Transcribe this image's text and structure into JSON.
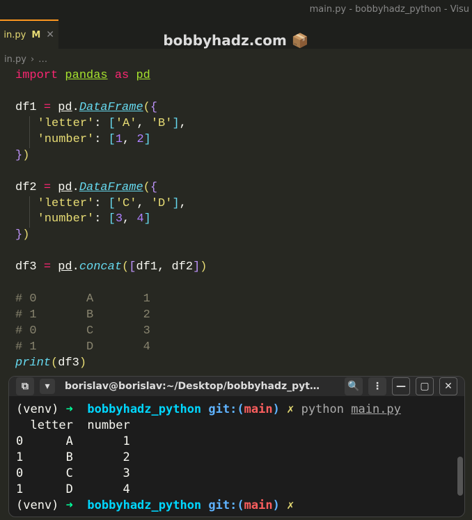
{
  "window": {
    "title": "main.py - bobbyhadz_python - Visu"
  },
  "tab": {
    "filename": "in.py",
    "modified_badge": "M",
    "close": "✕"
  },
  "watermark": {
    "text": "bobbyhadz.com",
    "icon": "📦"
  },
  "breadcrumb": {
    "file": "in.py",
    "sep": "›",
    "rest": "…"
  },
  "code": {
    "kw_import": "import",
    "mod_pandas": "pandas",
    "kw_as": "as",
    "alias_pd": "pd",
    "df1": "df1",
    "df2": "df2",
    "df3": "df3",
    "eq": "=",
    "pd": "pd",
    "dot": ".",
    "DataFrame": "DataFrame",
    "concat": "concat",
    "lparen_y": "(",
    "rparen_y": ")",
    "lbrace": "{",
    "rbrace": "}",
    "lbrack": "[",
    "rbrack": "]",
    "key_letter": "'letter'",
    "key_number": "'number'",
    "colon": ":",
    "comma": ",",
    "strA": "'A'",
    "strB": "'B'",
    "strC": "'C'",
    "strD": "'D'",
    "n1": "1",
    "n2": "2",
    "n3": "3",
    "n4": "4",
    "c1": "# 0       A       1",
    "c2": "# 1       B       2",
    "c3": "# 0       C       3",
    "c4": "# 1       D       4",
    "print": "print"
  },
  "terminal": {
    "header_title": "borislav@borislav:~/Desktop/bobbyhadz_pyt…",
    "venv": "(venv)",
    "arrow": "➜",
    "dir": "bobbyhadz_python",
    "git": "git:",
    "par_l": "(",
    "par_r": ")",
    "branch": "main",
    "dirty": "✗",
    "cmd_python": "python",
    "cmd_file": "main.py",
    "out_header": "  letter  number",
    "out_r1": "0      A       1",
    "out_r2": "1      B       2",
    "out_r3": "0      C       3",
    "out_r4": "1      D       4"
  },
  "icons": {
    "new_tab": "▾",
    "profile": "⧉",
    "search": "🔍",
    "menu": "⋮",
    "minimize": "—",
    "maximize": "▢",
    "close": "✕"
  }
}
